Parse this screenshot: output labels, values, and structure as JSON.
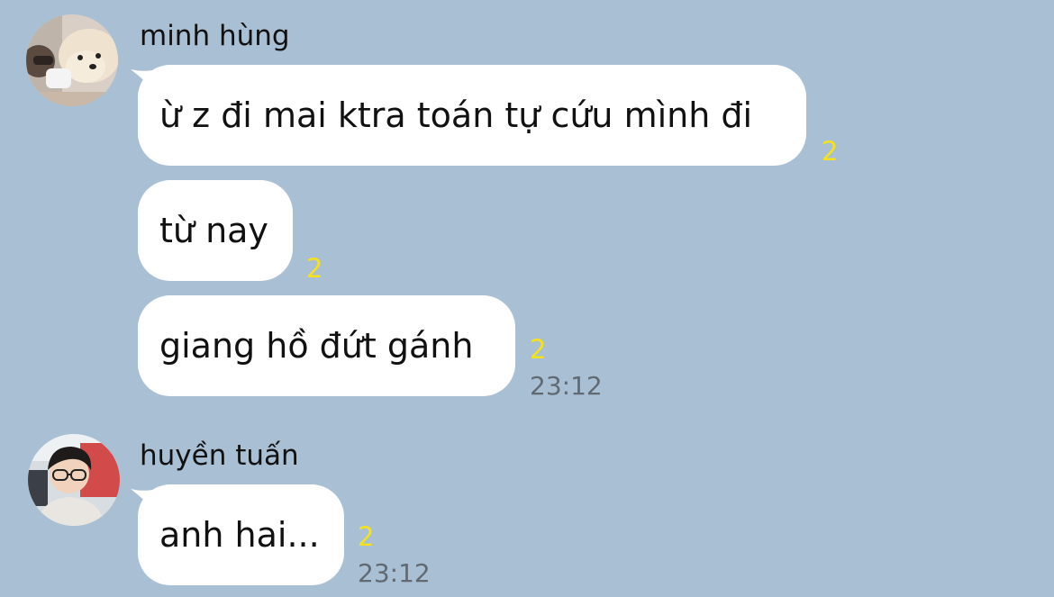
{
  "groups": [
    {
      "sender": "minh hùng",
      "avatar_icon": "avatar-puppy-icon",
      "messages": [
        {
          "text": "ừ z đi mai ktra toán tự cứu mình đi",
          "read_count": "2"
        },
        {
          "text": "từ nay",
          "read_count": "2"
        },
        {
          "text": "giang hồ đứt gánh",
          "read_count": "2",
          "time": "23:12"
        }
      ]
    },
    {
      "sender": "huyền tuấn",
      "avatar_icon": "avatar-boy-icon",
      "messages": [
        {
          "text": "anh hai...",
          "read_count": "2",
          "time": "23:12"
        }
      ]
    }
  ],
  "colors": {
    "background": "#a9bfd3",
    "bubble": "#ffffff",
    "read_count": "#f6e21a",
    "timestamp": "#616a73"
  }
}
